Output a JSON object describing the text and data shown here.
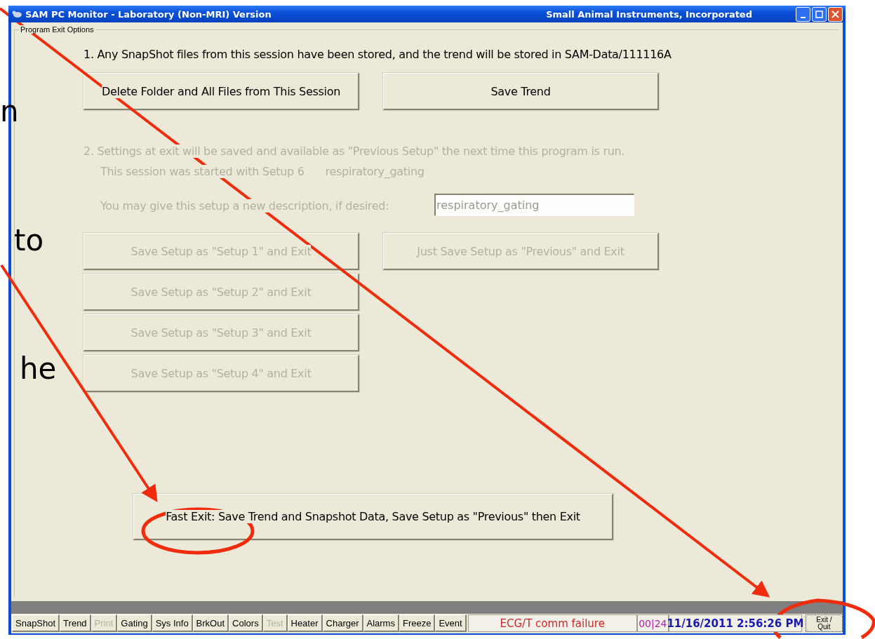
{
  "slide_text": [
    "n",
    "to",
    "he"
  ],
  "window": {
    "title": "SAM PC Monitor - Laboratory (Non-MRI) Version",
    "company": "Small Animal Instruments, Incorporated"
  },
  "group": {
    "label": "Program Exit Options"
  },
  "section1": {
    "text": "1.  Any SnapShot files from this session have been stored, and the trend will be stored in SAM-Data/111116A",
    "buttons": [
      {
        "label": "Delete Folder and All Files from This Session",
        "disabled": false
      },
      {
        "label": "Save Trend",
        "disabled": false
      }
    ]
  },
  "section2": {
    "disabled": true,
    "line1": "2.  Settings at exit will be saved and available as \"Previous Setup\" the next time this program is run.",
    "line2": "This session was started with Setup  6",
    "setup_name": "respiratory_gating",
    "description_label": "You may give this setup a new description, if desired:",
    "description_field": {
      "value": "respiratory_gating"
    },
    "setup_buttons": [
      {
        "label": "Save Setup as \"Setup 1\" and Exit",
        "disabled": true
      },
      {
        "label": "Save Setup as \"Setup 2\" and Exit",
        "disabled": true
      },
      {
        "label": "Save Setup as \"Setup 3\" and Exit",
        "disabled": true
      },
      {
        "label": "Save Setup as \"Setup 4\" and Exit",
        "disabled": true
      }
    ],
    "previous_button": {
      "label": "Just Save Setup as \"Previous\" and Exit",
      "disabled": true
    }
  },
  "fast_exit": {
    "label": "Fast Exit:  Save Trend and Snapshot Data, Save Setup as \"Previous\" then Exit",
    "disabled": false
  },
  "toolbar": [
    {
      "label": "SnapShot",
      "disabled": false
    },
    {
      "label": "Trend",
      "disabled": false
    },
    {
      "label": "Print",
      "disabled": true
    },
    {
      "label": "Gating",
      "disabled": false
    },
    {
      "label": "Sys Info",
      "disabled": false
    },
    {
      "label": "BrkOut",
      "disabled": false
    },
    {
      "label": "Colors",
      "disabled": false
    },
    {
      "label": "Test",
      "disabled": true
    },
    {
      "label": "Heater",
      "disabled": false
    },
    {
      "label": "Charger",
      "disabled": false
    },
    {
      "label": "Alarms",
      "disabled": false
    },
    {
      "label": "Freeze",
      "disabled": false
    },
    {
      "label": "Event",
      "disabled": false
    }
  ],
  "status": {
    "message": "ECG/T comm failure",
    "counter": "00|24",
    "datetime": "11/16/2011 2:56:26 PM",
    "exit_button": "Exit / Quit"
  }
}
